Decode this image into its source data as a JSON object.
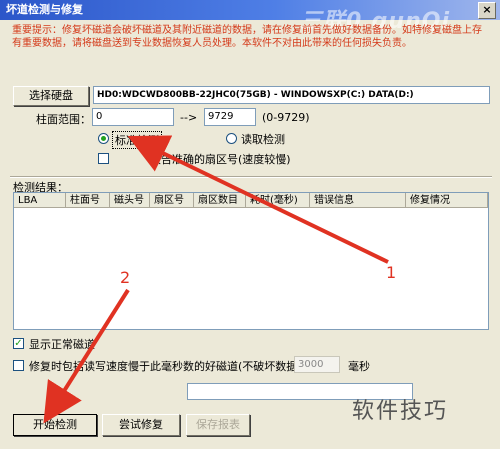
{
  "window": {
    "title": "坏道检测与修复",
    "close_label": "×",
    "watermark": "三联0.gunQi"
  },
  "warning": "重要提示：修复坏磁道会破坏磁道及其附近磁道的数据，请在修复前首先做好数据备份。如特修复磁盘上存有重要数据，请将磁盘送到专业数据恢复人员处理。本软件不对由此带来的任何损失负责。",
  "disk": {
    "button_label": "选择硬盘",
    "value": "HD0:WDCWD800BB-22JHC0(75GB) - WINDOWSXP(C:) DATA(D:)"
  },
  "range": {
    "label": "柱面范围：",
    "from": "0",
    "arrow": "-->",
    "to": "9729",
    "hint": "(0-9729)"
  },
  "mode": {
    "standard_label": "标准检测",
    "standard_selected": true,
    "read_label": "读取检测",
    "read_selected": false
  },
  "report_option": {
    "label": "报告准确的扇区号(速度较慢)",
    "checked": false
  },
  "results": {
    "label": "检测结果：",
    "columns": [
      "LBA",
      "柱面号",
      "磁头号",
      "扇区号",
      "扇区数目",
      "耗时(毫秒)",
      "错误信息",
      "修复情况"
    ]
  },
  "show_normal": {
    "label": "显示正常磁道",
    "checked": true
  },
  "repair_slow": {
    "label": "修复时包括读写速度慢于此毫秒数的好磁道(不破坏数据)：",
    "value": "3000",
    "unit": "毫秒",
    "checked": false
  },
  "buttons": {
    "start": "开始检测",
    "try_repair": "尝试修复",
    "save_report": "保存报表"
  },
  "annotations": {
    "one": "1",
    "two": "2"
  },
  "bottom_watermark": "软件技巧"
}
